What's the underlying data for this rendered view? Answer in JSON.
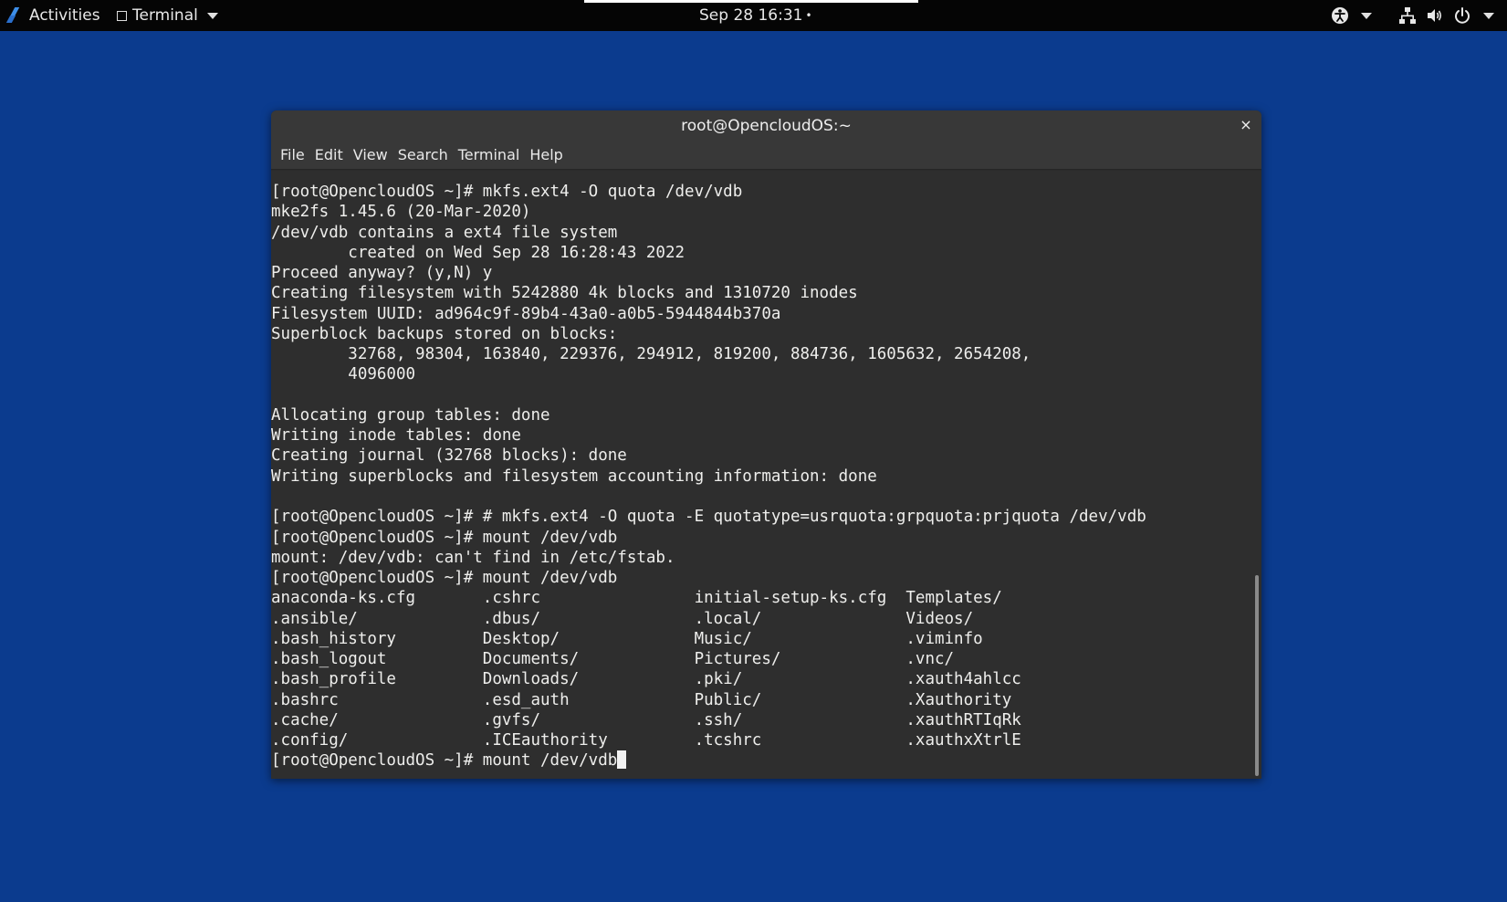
{
  "topbar": {
    "activities_label": "Activities",
    "app_label": "Terminal",
    "clock": "Sep 28  16:31",
    "clock_indicator": "•",
    "icons": {
      "logo": "distro-logo-icon",
      "accessibility": "accessibility-icon",
      "network": "network-icon",
      "volume": "volume-icon",
      "power": "power-icon"
    }
  },
  "window": {
    "title": "root@OpencloudOS:~",
    "close_glyph": "×",
    "menu": [
      {
        "label": "File"
      },
      {
        "label": "Edit"
      },
      {
        "label": "View"
      },
      {
        "label": "Search"
      },
      {
        "label": "Terminal"
      },
      {
        "label": "Help"
      }
    ]
  },
  "terminal": {
    "lines": [
      "[root@OpencloudOS ~]# mkfs.ext4 -O quota /dev/vdb",
      "mke2fs 1.45.6 (20-Mar-2020)",
      "/dev/vdb contains a ext4 file system",
      "        created on Wed Sep 28 16:28:43 2022",
      "Proceed anyway? (y,N) y",
      "Creating filesystem with 5242880 4k blocks and 1310720 inodes",
      "Filesystem UUID: ad964c9f-89b4-43a0-a0b5-5944844b370a",
      "Superblock backups stored on blocks:",
      "        32768, 98304, 163840, 229376, 294912, 819200, 884736, 1605632, 2654208,",
      "        4096000",
      "",
      "Allocating group tables: done",
      "Writing inode tables: done",
      "Creating journal (32768 blocks): done",
      "Writing superblocks and filesystem accounting information: done",
      "",
      "[root@OpencloudOS ~]# # mkfs.ext4 -O quota -E quotatype=usrquota:grpquota:prjquota /dev/vdb",
      "[root@OpencloudOS ~]# mount /dev/vdb",
      "mount: /dev/vdb: can't find in /etc/fstab.",
      "[root@OpencloudOS ~]# mount /dev/vdb",
      "anaconda-ks.cfg       .cshrc                initial-setup-ks.cfg  Templates/",
      ".ansible/             .dbus/                .local/               Videos/",
      ".bash_history         Desktop/              Music/                .viminfo",
      ".bash_logout          Documents/            Pictures/             .vnc/",
      ".bash_profile         Downloads/            .pki/                 .xauth4ahlcc",
      ".bashrc               .esd_auth             Public/               .Xauthority",
      ".cache/               .gvfs/                .ssh/                 .xauthRTIqRk",
      ".config/              .ICEauthority         .tcshrc               .xauthxXtrlE"
    ],
    "prompt_line": "[root@OpencloudOS ~]# mount /dev/vdb"
  }
}
